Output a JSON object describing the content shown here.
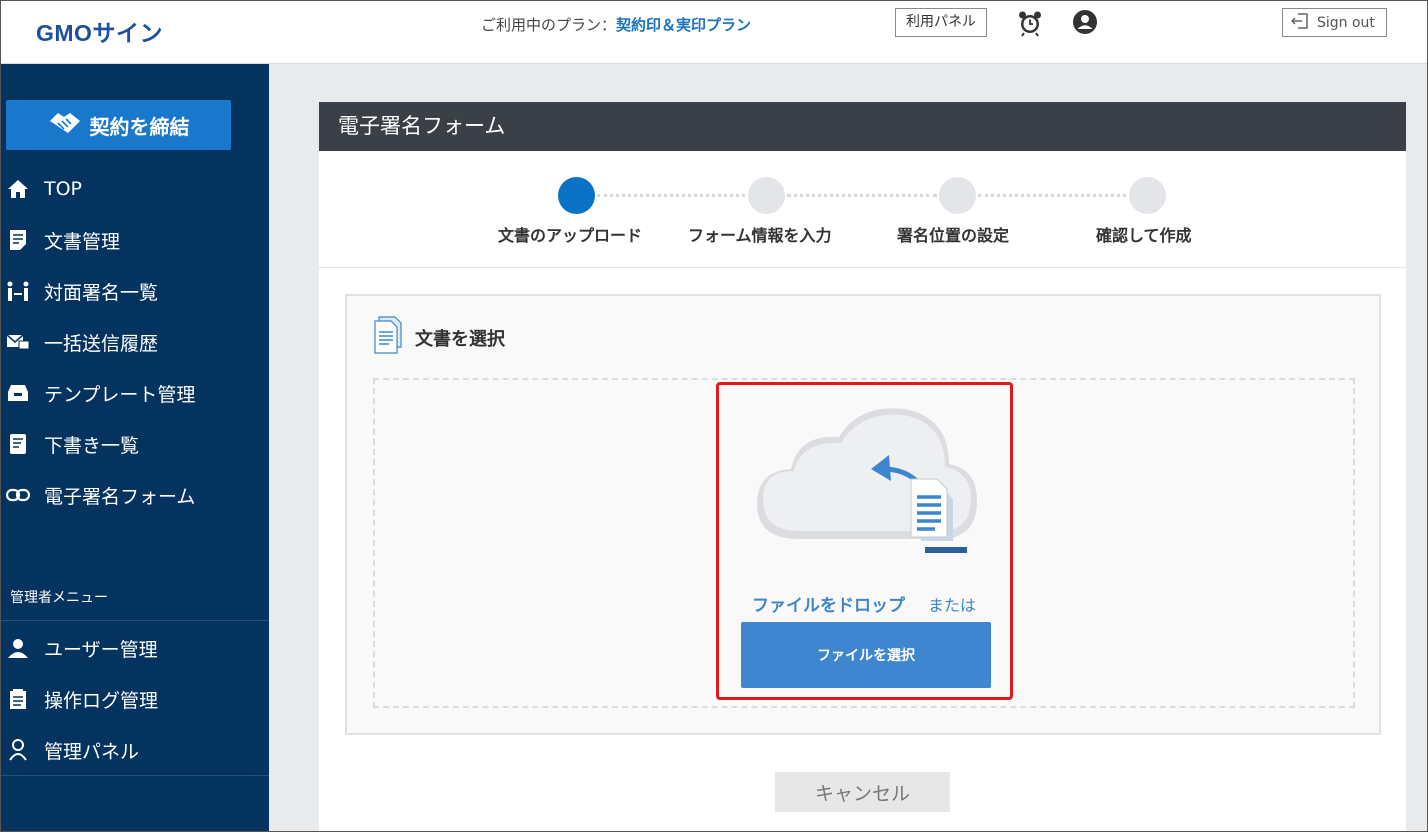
{
  "header": {
    "logo_text": "GMOサイン",
    "plan_prefix": "ご利用中のプラン：",
    "plan_name": "契約印＆実印プラン",
    "panel_button": "利用パネル",
    "signout_label": "Sign out"
  },
  "sidebar": {
    "contract_button": "契約を締結",
    "items": [
      {
        "label": "TOP",
        "icon": "home-icon"
      },
      {
        "label": "文書管理",
        "icon": "document-icon"
      },
      {
        "label": "対面署名一覧",
        "icon": "face-to-face-icon"
      },
      {
        "label": "一括送信履歴",
        "icon": "bulk-send-icon"
      },
      {
        "label": "テンプレート管理",
        "icon": "template-icon"
      },
      {
        "label": "下書き一覧",
        "icon": "draft-icon"
      },
      {
        "label": "電子署名フォーム",
        "icon": "link-icon"
      }
    ],
    "admin_heading": "管理者メニュー",
    "admin_items": [
      {
        "label": "ユーザー管理",
        "icon": "user-icon"
      },
      {
        "label": "操作ログ管理",
        "icon": "log-icon"
      },
      {
        "label": "管理パネル",
        "icon": "admin-panel-icon"
      }
    ]
  },
  "main": {
    "title": "電子署名フォーム",
    "steps": [
      {
        "label": "文書のアップロード",
        "active": true
      },
      {
        "label": "フォーム情報を入力",
        "active": false
      },
      {
        "label": "署名位置の設定",
        "active": false
      },
      {
        "label": "確認して作成",
        "active": false
      }
    ],
    "select_title": "文書を選択",
    "drop_text": "ファイルをドロップ",
    "or_text": "または",
    "select_file_button": "ファイルを選択",
    "cancel_button": "キャンセル"
  },
  "colors": {
    "sidebar_bg": "#05335f",
    "accent": "#1a78cc",
    "highlight": "#e01a1a",
    "header_dark": "#3b4048"
  }
}
